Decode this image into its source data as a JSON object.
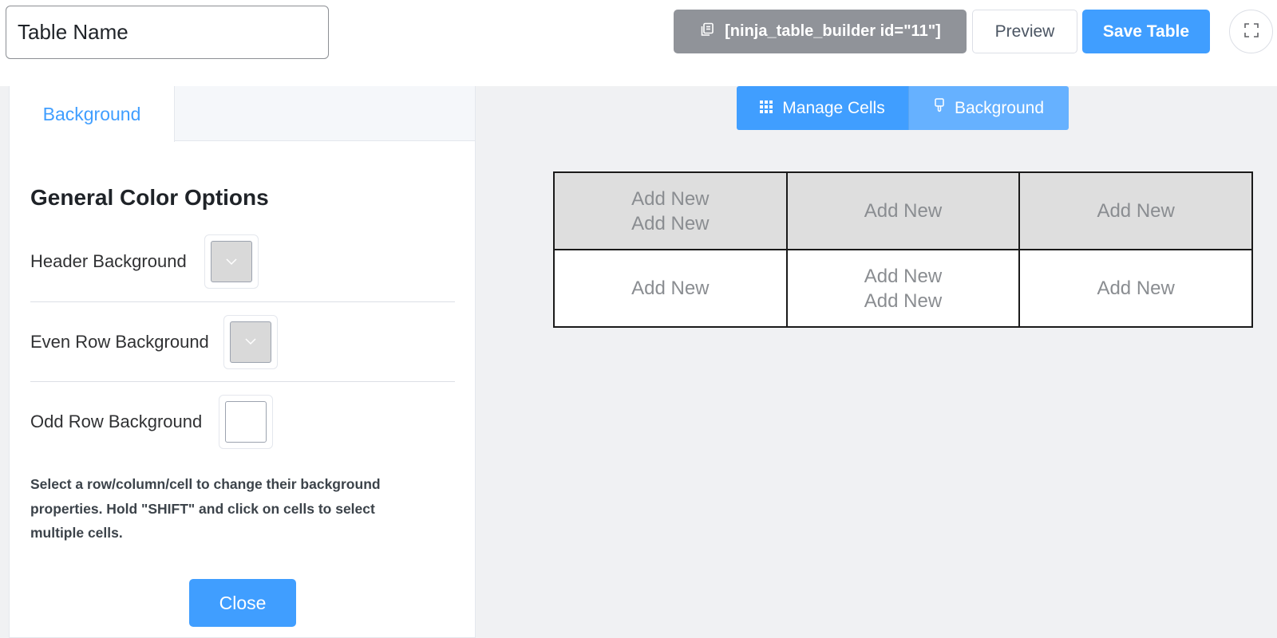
{
  "topbar": {
    "table_name_value": "Table Name",
    "shortcode_label": "[ninja_table_builder id=\"11\"]",
    "preview_label": "Preview",
    "save_label": "Save Table"
  },
  "panel": {
    "tab_label": "Background",
    "heading": "General Color Options",
    "options": [
      {
        "label": "Header Background",
        "color": "#d9d9d9"
      },
      {
        "label": "Even Row Background",
        "color": "#d9d9d9"
      },
      {
        "label": "Odd Row Background",
        "color": "#ffffff"
      }
    ],
    "help_text": "Select a row/column/cell to change their background properties. Hold \"SHIFT\" and click on cells to select multiple cells.",
    "close_label": "Close"
  },
  "mode_switch": {
    "manage_label": "Manage Cells",
    "background_label": "Background"
  },
  "table": {
    "rows": [
      [
        [
          "Add New",
          "Add New"
        ],
        [
          "Add New"
        ],
        [
          "Add New"
        ]
      ],
      [
        [
          "Add New"
        ],
        [
          "Add New",
          "Add New"
        ],
        [
          "Add New"
        ]
      ]
    ]
  },
  "colors": {
    "accent": "#409eff",
    "accent_light": "#66b1ff",
    "shortcode_bg": "#909399",
    "canvas_bg": "#f0f1f3",
    "header_row_bg": "#dedede"
  },
  "icons": {
    "shortcode": "copy-icon",
    "manage": "grid-icon",
    "background": "paint-brush-icon",
    "fullscreen": "fullscreen-icon"
  }
}
